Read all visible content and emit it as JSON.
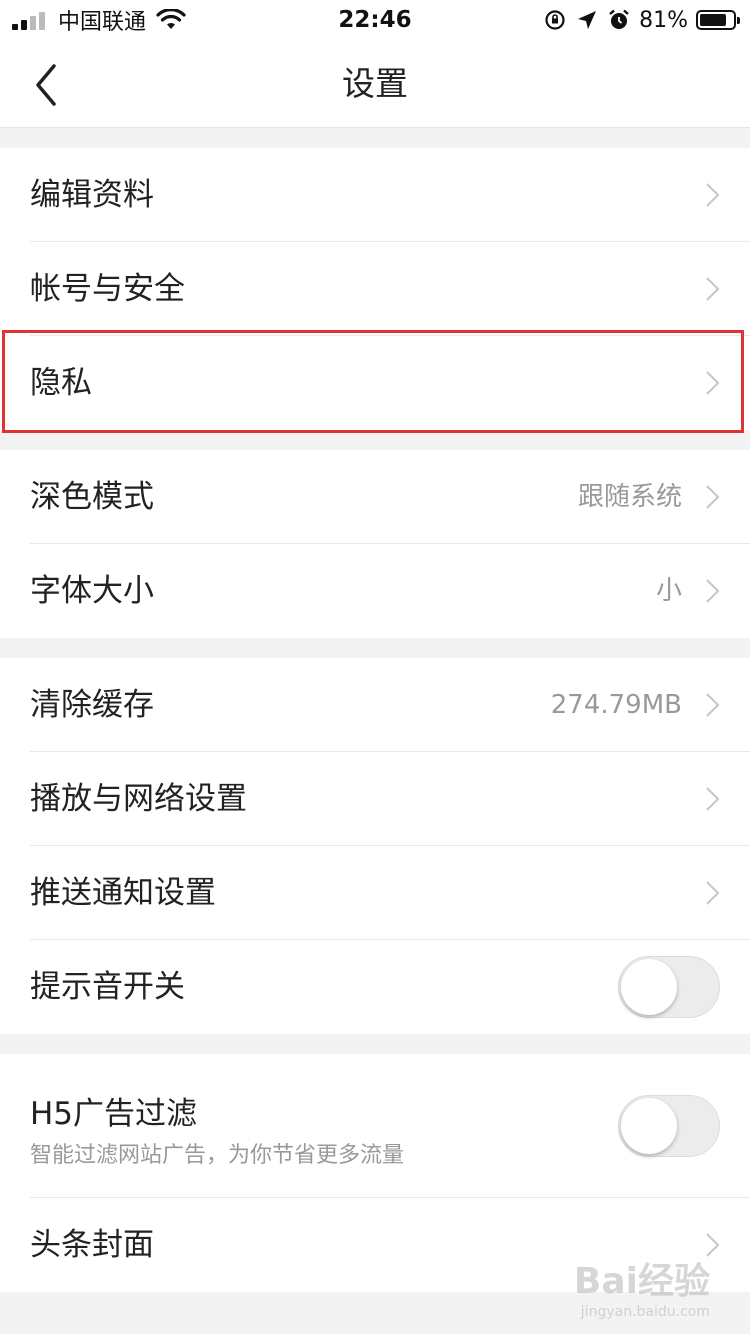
{
  "status_bar": {
    "carrier": "中国联通",
    "time": "22:46",
    "battery_percent": "81%",
    "battery_level": 0.81,
    "icons": [
      "signal-icon",
      "wifi-icon",
      "orientation-lock-icon",
      "location-icon",
      "alarm-icon",
      "battery-icon"
    ]
  },
  "navbar": {
    "title": "设置",
    "back_icon": "chevron-left-icon"
  },
  "groups": [
    {
      "items": [
        {
          "label": "编辑资料",
          "type": "link"
        },
        {
          "label": "帐号与安全",
          "type": "link"
        },
        {
          "label": "隐私",
          "type": "link",
          "highlighted": true
        }
      ]
    },
    {
      "items": [
        {
          "label": "深色模式",
          "value": "跟随系统",
          "type": "link"
        },
        {
          "label": "字体大小",
          "value": "小",
          "type": "link"
        }
      ]
    },
    {
      "items": [
        {
          "label": "清除缓存",
          "value": "274.79MB",
          "type": "link"
        },
        {
          "label": "播放与网络设置",
          "type": "link"
        },
        {
          "label": "推送通知设置",
          "type": "link"
        },
        {
          "label": "提示音开关",
          "type": "toggle",
          "on": false
        }
      ]
    },
    {
      "items": [
        {
          "label": "H5广告过滤",
          "subtitle": "智能过滤网站广告，为你节省更多流量",
          "type": "toggle",
          "on": false
        },
        {
          "label": "头条封面",
          "type": "link"
        }
      ]
    }
  ],
  "colors": {
    "highlight": "#e03434",
    "background": "#f3f3f3",
    "secondary_text": "#999999"
  },
  "watermark": {
    "text": "Bai经验",
    "sub": "jingyan.baidu.com"
  }
}
